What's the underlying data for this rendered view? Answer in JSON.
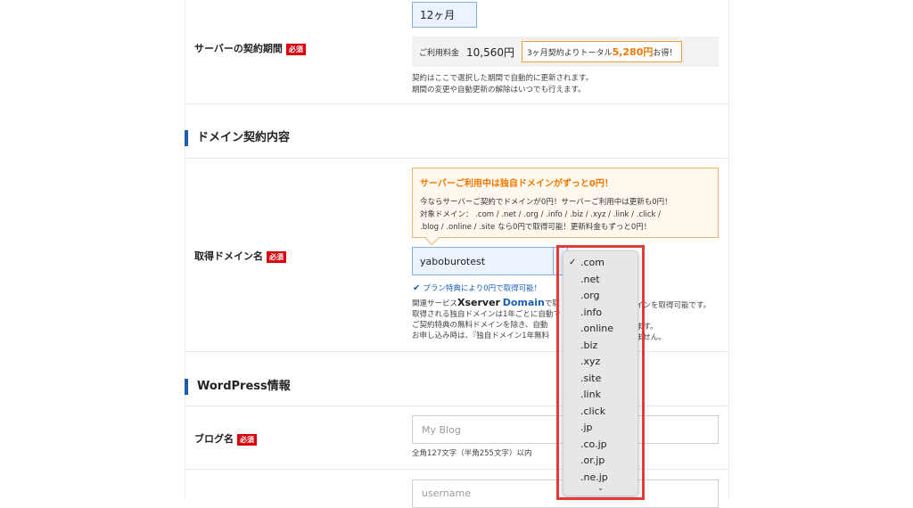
{
  "contract": {
    "label": "サーバーの契約期間",
    "required_badge": "必須",
    "period_value": "12ヶ月",
    "fee_label": "ご利用料金",
    "fee_amount": "10,560円",
    "badge_prefix": "3ヶ月契約よりトータル",
    "badge_amount": "5,280円",
    "badge_suffix": "お得！",
    "note_line1": "契約はここで選択した期間で自動的に更新されます。",
    "note_line2": "期間の変更や自動更新の解除はいつでも行えます。"
  },
  "domain_section": {
    "title": "ドメイン契約内容"
  },
  "domain": {
    "label": "取得ドメイン名",
    "required_badge": "必須",
    "promo_title": "サーバーご利用中は独自ドメインがずっと0円！",
    "promo_line1": "今ならサーバーご契約でドメインが0円！サーバーご利用中は更新も0円！",
    "promo_line2": "対象ドメイン： .com / .net / .org / .info / .biz / .xyz / .link / .click /",
    "promo_line3": ".blog / .online / .site なら0円で取得可能！更新料金もずっと0円！",
    "input_value": "yaboburotest",
    "check_text": "プラン特典により0円で取得可能！",
    "related_prefix": "関連サービス",
    "related_brand1": "Xserver",
    "related_brand2": "Domain",
    "related_line1_tail": "で取",
    "related_line1_right": "インを取得可能です。",
    "related_line2": "取得される独自ドメインは1年ごとに自動で",
    "related_line3": "ご契約特典の無料ドメインを除き、自動",
    "related_line3_right": "ます。",
    "related_line4": "お申し込み時は、『独自ドメイン1年無料",
    "related_line4_right": "ません。"
  },
  "tld_dropdown": {
    "selected_mark": "✓",
    "options": [
      ".com",
      ".net",
      ".org",
      ".info",
      ".online",
      ".biz",
      ".xyz",
      ".site",
      ".link",
      ".click",
      ".jp",
      ".co.jp",
      ".or.jp",
      ".ne.jp"
    ],
    "chevron": "⌄"
  },
  "wordpress_section": {
    "title": "WordPress情報"
  },
  "blog": {
    "label": "ブログ名",
    "required_badge": "必須",
    "placeholder": "My Blog",
    "hint": "全角127文字（半角255文字）以内"
  },
  "username": {
    "placeholder": "username"
  },
  "colors": {
    "required_red": "#d9000a",
    "accent_blue": "#1a5fb4",
    "promo_orange": "#f07800",
    "highlight_red": "#e53935"
  }
}
